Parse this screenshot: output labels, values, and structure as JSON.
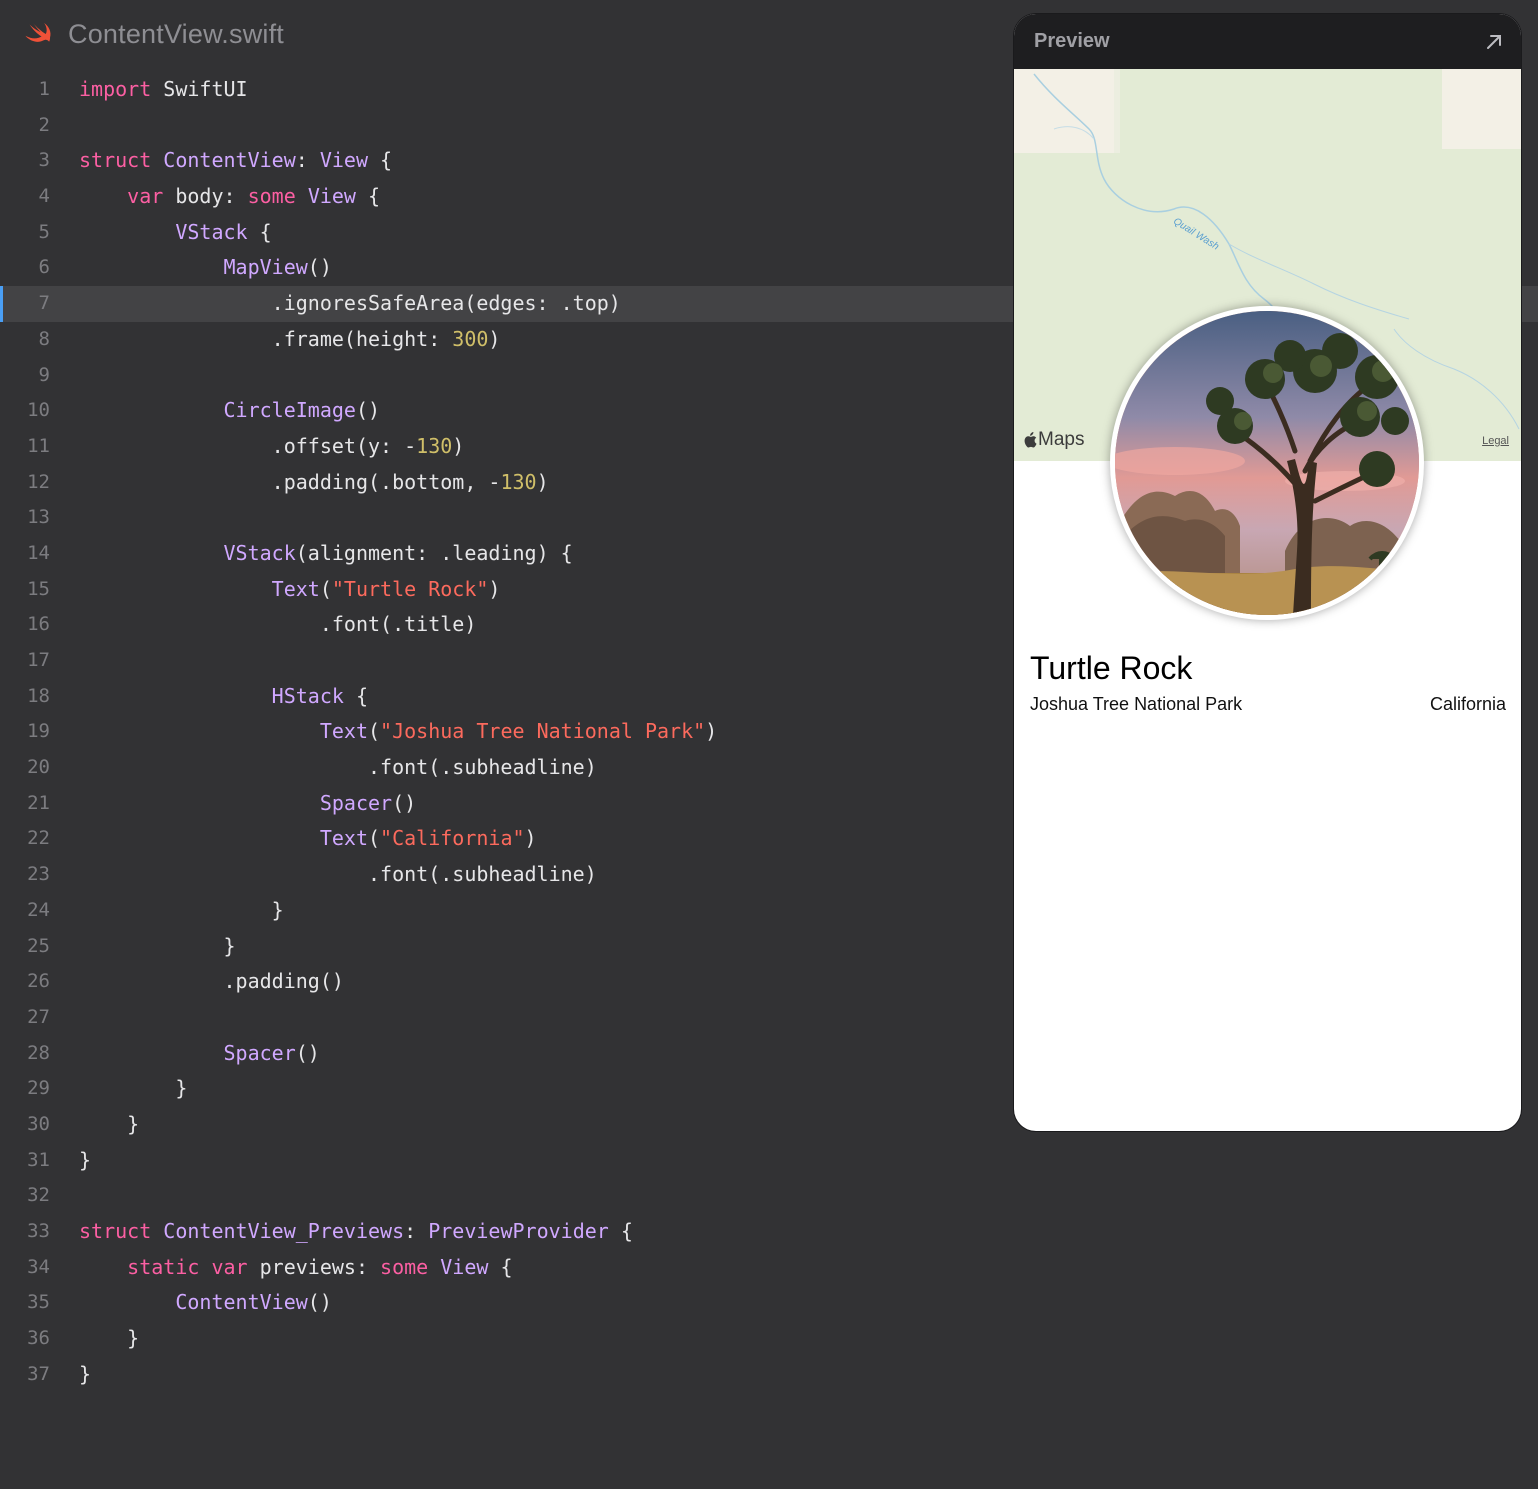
{
  "editor": {
    "file_name": "ContentView.swift",
    "file_icon": "swift-icon",
    "current_line": 7,
    "lines": [
      {
        "n": "1",
        "code": "<span class=\"kw\">import</span> SwiftUI"
      },
      {
        "n": "2",
        "code": ""
      },
      {
        "n": "3",
        "code": "<span class=\"kw\">struct</span> <span class=\"ty\">ContentView</span>: <span class=\"ty\">View</span> {"
      },
      {
        "n": "4",
        "code": "    <span class=\"kw\">var</span> body: <span class=\"kw\">some</span> <span class=\"ty\">View</span> {"
      },
      {
        "n": "5",
        "code": "        <span class=\"ty\">VStack</span> {"
      },
      {
        "n": "6",
        "code": "            <span class=\"ty\">MapView</span>()"
      },
      {
        "n": "7",
        "code": "                .ignoresSafeArea(edges: .top)"
      },
      {
        "n": "8",
        "code": "                .frame(height: <span class=\"nu\">300</span>)"
      },
      {
        "n": "9",
        "code": ""
      },
      {
        "n": "10",
        "code": "            <span class=\"ty\">CircleImage</span>()"
      },
      {
        "n": "11",
        "code": "                .offset(y: -<span class=\"nu\">130</span>)"
      },
      {
        "n": "12",
        "code": "                .padding(.bottom, -<span class=\"nu\">130</span>)"
      },
      {
        "n": "13",
        "code": ""
      },
      {
        "n": "14",
        "code": "            <span class=\"ty\">VStack</span>(alignment: .leading) {"
      },
      {
        "n": "15",
        "code": "                <span class=\"ty\">Text</span>(<span class=\"st\">\"Turtle Rock\"</span>)"
      },
      {
        "n": "16",
        "code": "                    .font(.title)"
      },
      {
        "n": "17",
        "code": ""
      },
      {
        "n": "18",
        "code": "                <span class=\"ty\">HStack</span> {"
      },
      {
        "n": "19",
        "code": "                    <span class=\"ty\">Text</span>(<span class=\"st\">\"Joshua Tree National Park\"</span>)"
      },
      {
        "n": "20",
        "code": "                        .font(.subheadline)"
      },
      {
        "n": "21",
        "code": "                    <span class=\"ty\">Spacer</span>()"
      },
      {
        "n": "22",
        "code": "                    <span class=\"ty\">Text</span>(<span class=\"st\">\"California\"</span>)"
      },
      {
        "n": "23",
        "code": "                        .font(.subheadline)"
      },
      {
        "n": "24",
        "code": "                }"
      },
      {
        "n": "25",
        "code": "            }"
      },
      {
        "n": "26",
        "code": "            .padding()"
      },
      {
        "n": "27",
        "code": ""
      },
      {
        "n": "28",
        "code": "            <span class=\"ty\">Spacer</span>()"
      },
      {
        "n": "29",
        "code": "        }"
      },
      {
        "n": "30",
        "code": "    }"
      },
      {
        "n": "31",
        "code": "}"
      },
      {
        "n": "32",
        "code": ""
      },
      {
        "n": "33",
        "code": "<span class=\"kw\">struct</span> <span class=\"ty\">ContentView_Previews</span>: <span class=\"ty\">PreviewProvider</span> {"
      },
      {
        "n": "34",
        "code": "    <span class=\"kw\">static</span> <span class=\"kw\">var</span> previews: <span class=\"kw\">some</span> <span class=\"ty\">View</span> {"
      },
      {
        "n": "35",
        "code": "        <span class=\"ty\">ContentView</span>()"
      },
      {
        "n": "36",
        "code": "    }"
      },
      {
        "n": "37",
        "code": "}"
      }
    ],
    "colors": {
      "background": "#323234",
      "keyword": "#fc5fa3",
      "type": "#d0a8ff",
      "string": "#fc6a5d",
      "number": "#d0bf69",
      "plain": "#e6e6e8"
    }
  },
  "preview": {
    "title": "Preview",
    "expand_icon": "arrow-up-right-icon",
    "map": {
      "attribution": "Maps",
      "attribution_icon": "apple-logo-icon",
      "legal": "Legal",
      "feature_label": "Quail Wash"
    },
    "landmark": {
      "name": "Turtle Rock",
      "park": "Joshua Tree National Park",
      "state": "California"
    }
  }
}
